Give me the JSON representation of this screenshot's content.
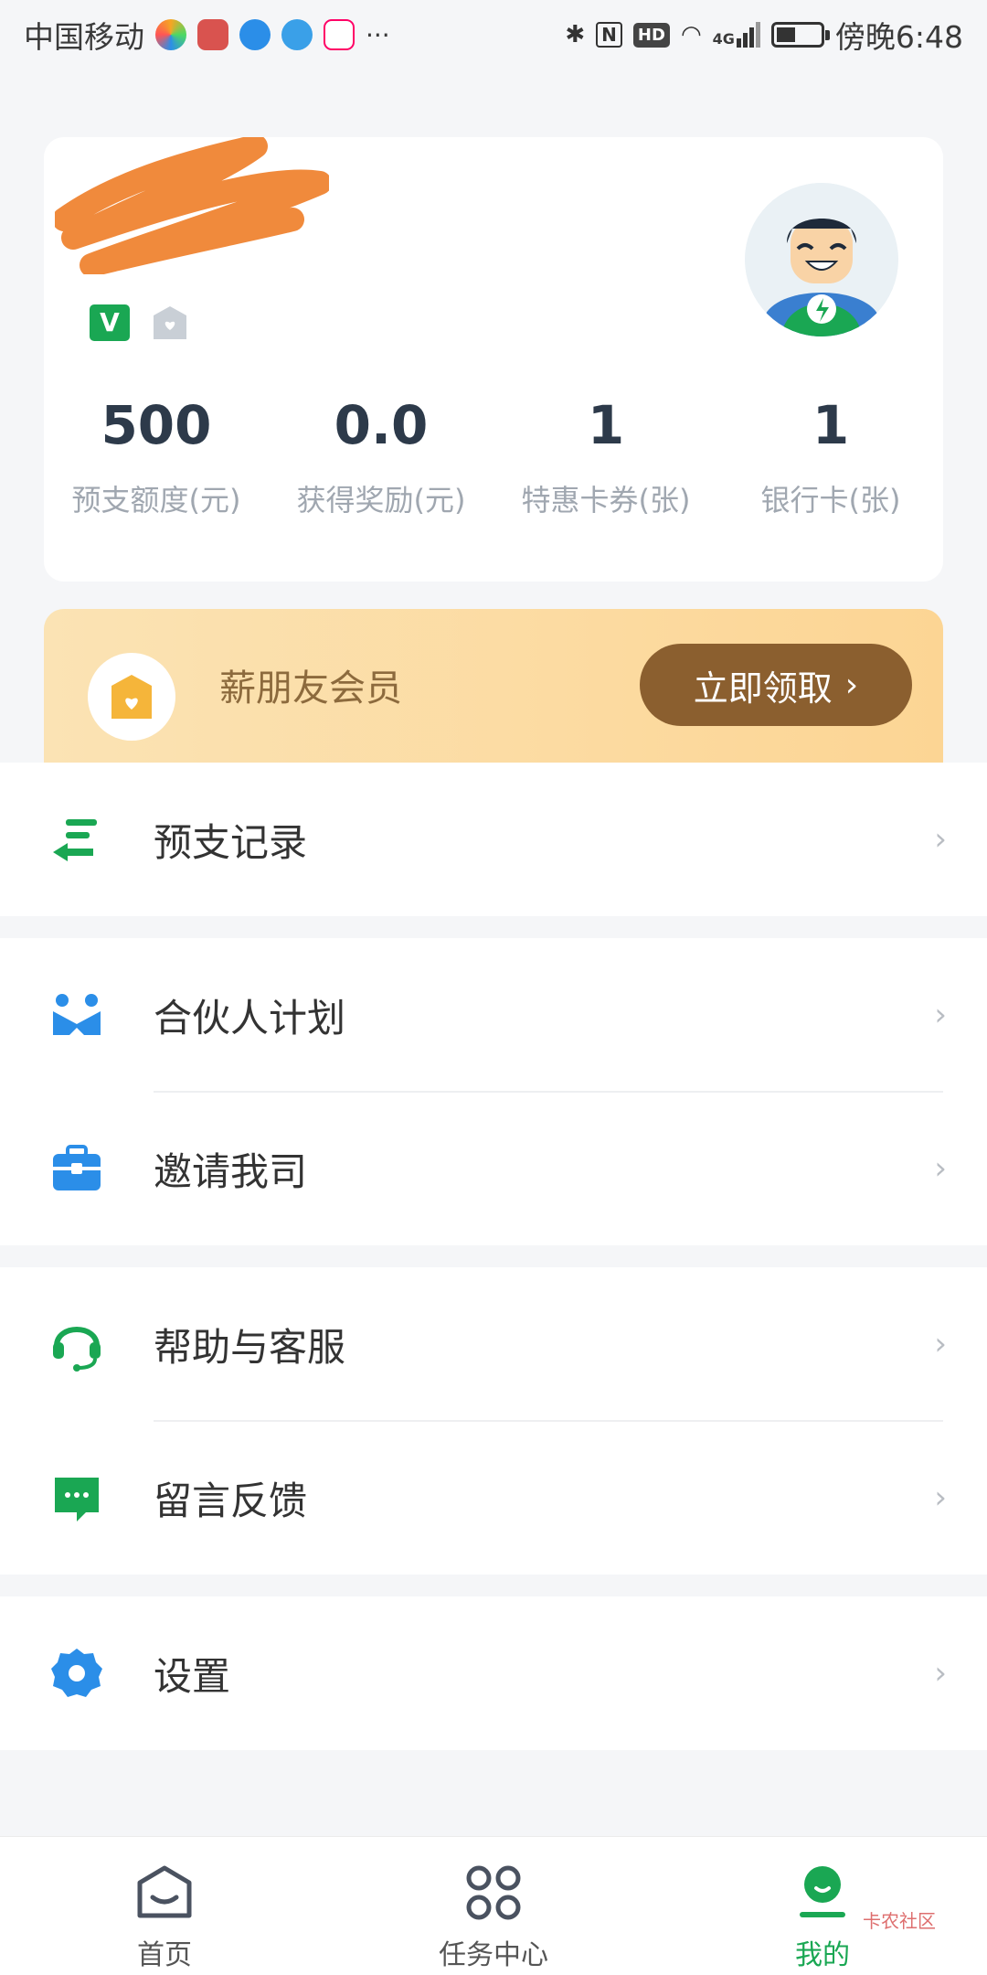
{
  "status_bar": {
    "carrier": "中国移动",
    "time": "傍晚6:48",
    "more": "···",
    "signal": "4G",
    "hd": "HD"
  },
  "profile": {
    "badge_v": "V",
    "stats": [
      {
        "value": "500",
        "label": "预支额度(元)"
      },
      {
        "value": "0.0",
        "label": "获得奖励(元)"
      },
      {
        "value": "1",
        "label": "特惠卡券(张)"
      },
      {
        "value": "1",
        "label": "银行卡(张)"
      }
    ]
  },
  "vip": {
    "title": "薪朋友会员",
    "button": "立即领取"
  },
  "menu": {
    "advance_records": "预支记录",
    "partner_plan": "合伙人计划",
    "invite_company": "邀请我司",
    "help_service": "帮助与客服",
    "feedback": "留言反馈",
    "settings": "设置"
  },
  "tabs": {
    "home": "首页",
    "task_center": "任务中心",
    "mine": "我的"
  },
  "watermark": "卡农社区",
  "colors": {
    "accent_green": "#1aa753",
    "accent_blue": "#2b8ee8",
    "vip_brown": "#8b5f2f"
  }
}
